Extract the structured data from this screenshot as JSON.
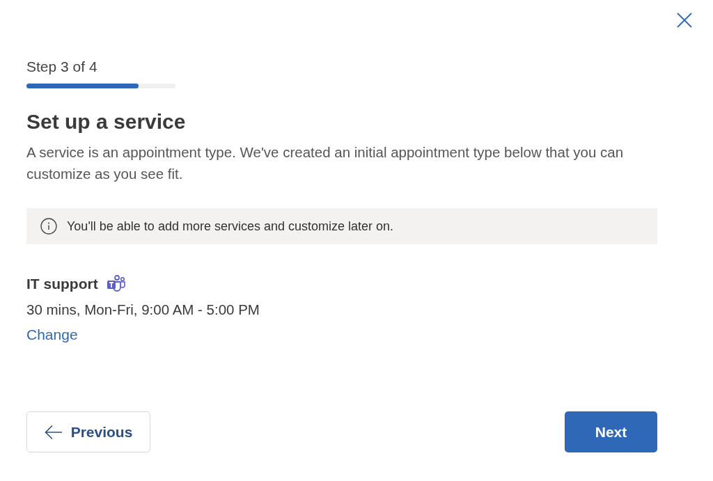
{
  "step": {
    "label": "Step 3 of 4",
    "level": 0.75
  },
  "title": "Set up a service",
  "description": "A service is an appointment type. We've created an initial appointment type below that you can customize as you see fit.",
  "notice": {
    "text": "You'll be able to add more services and customize later on."
  },
  "service": {
    "name": "IT support",
    "details": "30 mins, Mon-Fri, 9:00 AM - 5:00 PM",
    "link": "Change"
  },
  "buttons": [
    {
      "kind": "secondary",
      "label": "Previous"
    },
    {
      "kind": "primary",
      "label": "Next"
    }
  ]
}
